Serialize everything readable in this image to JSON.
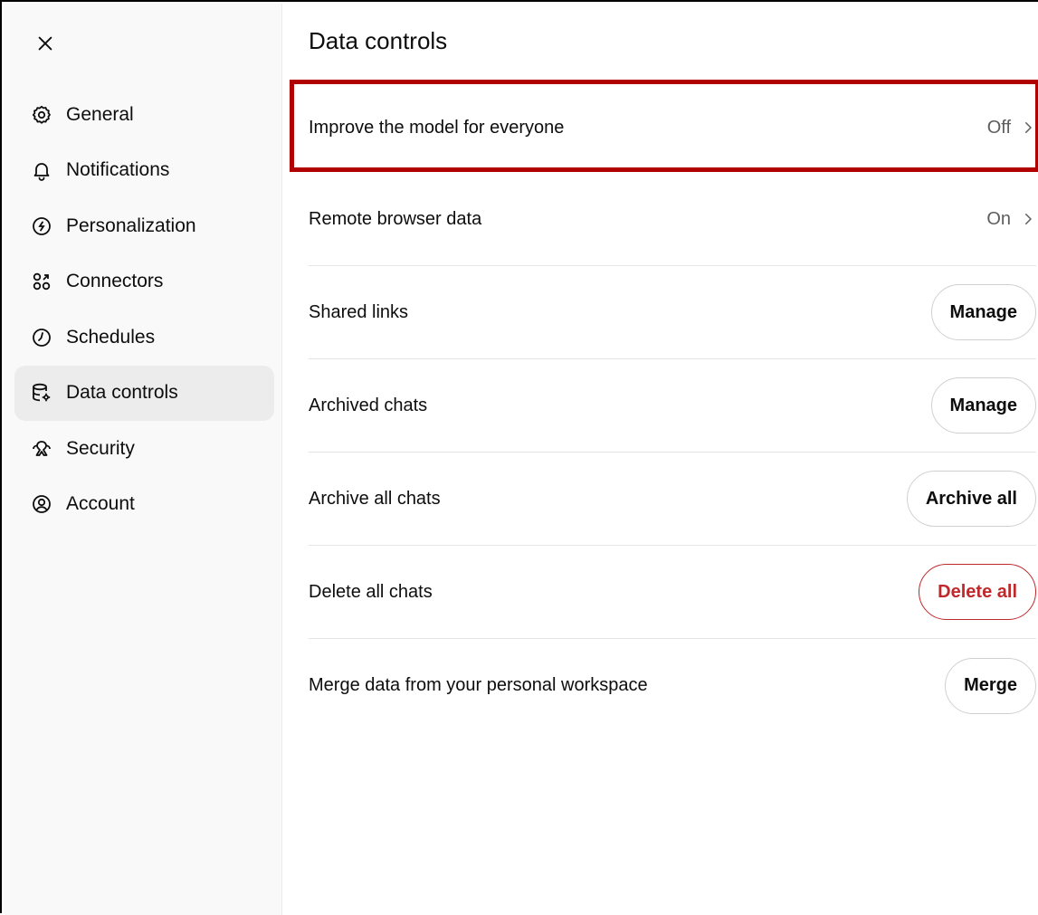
{
  "sidebar": {
    "items": [
      {
        "label": "General",
        "icon": "gear-icon",
        "active": false
      },
      {
        "label": "Notifications",
        "icon": "bell-icon",
        "active": false
      },
      {
        "label": "Personalization",
        "icon": "personalization-icon",
        "active": false
      },
      {
        "label": "Connectors",
        "icon": "connectors-icon",
        "active": false
      },
      {
        "label": "Schedules",
        "icon": "clock-icon",
        "active": false
      },
      {
        "label": "Data controls",
        "icon": "database-gear-icon",
        "active": true
      },
      {
        "label": "Security",
        "icon": "security-icon",
        "active": false
      },
      {
        "label": "Account",
        "icon": "account-icon",
        "active": false
      }
    ]
  },
  "main": {
    "title": "Data controls",
    "rows": [
      {
        "label": "Improve the model for everyone",
        "value": "Off"
      },
      {
        "label": "Remote browser data",
        "value": "On"
      },
      {
        "label": "Shared links",
        "button": "Manage"
      },
      {
        "label": "Archived chats",
        "button": "Manage"
      },
      {
        "label": "Archive all chats",
        "button": "Archive all"
      },
      {
        "label": "Delete all chats",
        "button": "Delete all"
      },
      {
        "label": "Merge data from your personal workspace",
        "button": "Merge"
      }
    ]
  },
  "colors": {
    "danger": "#c0292b",
    "highlight": "#b00000",
    "sidebar_bg": "#f9f9f9",
    "active_bg": "#ececec"
  }
}
